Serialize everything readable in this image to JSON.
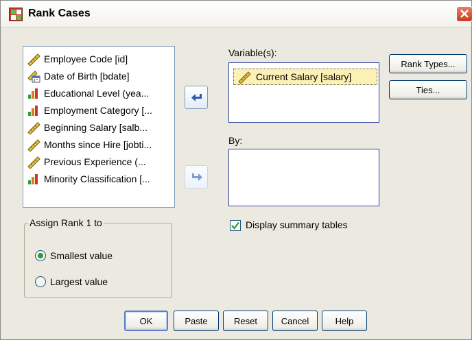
{
  "window": {
    "title": "Rank Cases"
  },
  "source_variables": [
    {
      "label": "Employee Code [id]",
      "icon": "ruler-icon"
    },
    {
      "label": "Date of Birth [bdate]",
      "icon": "date-ruler-icon"
    },
    {
      "label": "Educational Level (yea...",
      "icon": "bar-chart-icon"
    },
    {
      "label": "Employment Category [...",
      "icon": "bar-chart-icon"
    },
    {
      "label": "Beginning Salary [salb...",
      "icon": "ruler-icon"
    },
    {
      "label": "Months since Hire [jobti...",
      "icon": "ruler-icon"
    },
    {
      "label": "Previous Experience (...",
      "icon": "ruler-icon"
    },
    {
      "label": "Minority Classification [...",
      "icon": "bar-chart-icon"
    }
  ],
  "variables": {
    "label": "Variable(s):",
    "items": [
      {
        "label": "Current Salary [salary]",
        "icon": "ruler-icon"
      }
    ]
  },
  "by": {
    "label": "By:",
    "items": []
  },
  "side_buttons": {
    "rank_types": "Rank Types...",
    "ties": "Ties..."
  },
  "summary": {
    "label": "Display summary tables",
    "checked": true
  },
  "assign_rank": {
    "title": "Assign Rank 1 to",
    "options": [
      {
        "label": "Smallest value",
        "selected": true
      },
      {
        "label": "Largest value",
        "selected": false
      }
    ]
  },
  "footer": {
    "ok": "OK",
    "paste": "Paste",
    "reset": "Reset",
    "cancel": "Cancel",
    "help": "Help"
  },
  "colors": {
    "accent": "#2a3e9c",
    "selection": "#fcf1b5",
    "window_bg": "#eceae0"
  }
}
